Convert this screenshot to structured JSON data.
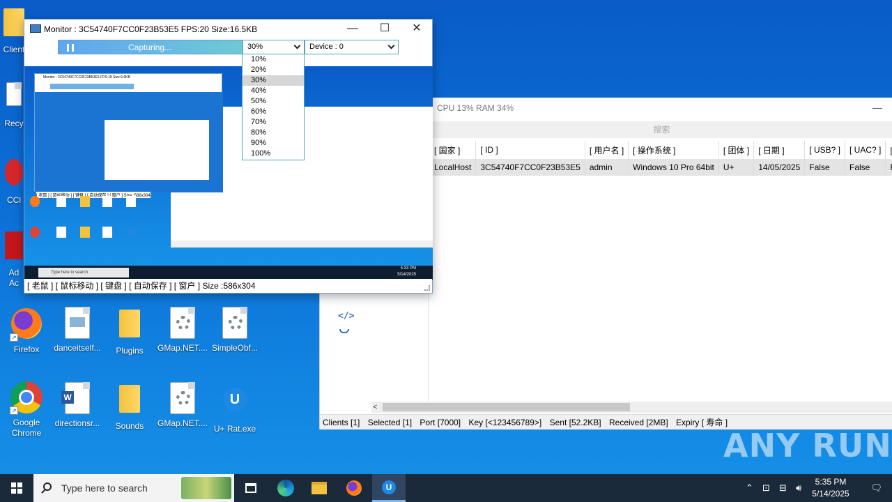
{
  "desktop": {
    "icons": [
      {
        "label": "Firefox"
      },
      {
        "label": "danceitself..."
      },
      {
        "label": "Plugins"
      },
      {
        "label": "GMap.NET...."
      },
      {
        "label": "SimpleObf..."
      },
      {
        "label": "Google Chrome"
      },
      {
        "label": "directionsr..."
      },
      {
        "label": "Sounds"
      },
      {
        "label": "GMap.NET...."
      },
      {
        "label": "U+ Rat.exe"
      }
    ],
    "partial_labels": [
      "Client",
      "Recy",
      "CCl",
      "Ad",
      "Ac"
    ]
  },
  "monitor": {
    "title": "Monitor : 3C54740F7CC0F23B53E5  FPS:20  Size:16.5KB",
    "capture_label": "Capturing...",
    "quality_selected": "30%",
    "device_selected": "Device : 0",
    "quality_options": [
      "10%",
      "20%",
      "30%",
      "40%",
      "50%",
      "60%",
      "70%",
      "80%",
      "90%",
      "100%"
    ],
    "status": {
      "mouse": "[ 老鼠 ]",
      "mouse_move": "[ 鼠标移动 ]",
      "keyboard": "[ 键盘 ]",
      "autosave": "[ 自动保存 ]",
      "window": "[ 窗户 ]",
      "size": "Size :586x304"
    },
    "preview": {
      "mini_title": "Monitor : 3C54740F7CC0F23B53E5  FPS:18  Size:9.6KB",
      "mini_search": "Type here to search",
      "mini_clock_time": "5:33 PM",
      "mini_clock_date": "5/14/2025",
      "mini_status": "[ 老鼠 ] [ 鼠标移动 ] [ 键盘 ] [ 自动保存 ] [ 窗户 ] Size :586x304"
    }
  },
  "main_app": {
    "stats": "CPU 13%  RAM 34%",
    "search_placeholder": "搜索",
    "columns": [
      "[ 国家 ]",
      "[ ID ]",
      "[ 用户名 ]",
      "[ 操作系统 ]",
      "[ 团体 ]",
      "[ 日期 ]",
      "[ USB? ]",
      "[ UAC? ]",
      "[ 相机? ]"
    ],
    "rows": [
      [
        "LocalHost",
        "3C54740F7CC0F23B53E5",
        "admin",
        "Windows 10 Pro 64bit",
        "U+",
        "14/05/2025",
        "False",
        "False",
        "False"
      ]
    ],
    "statusbar": {
      "clients": "Clients [1]",
      "selected": "Selected [1]",
      "port": "Port [7000]",
      "key": "Key [<123456789>]",
      "sent": "Sent [52.2KB]",
      "received": "Received [2MB]",
      "expiry": "Expiry [ 寿命 ]"
    }
  },
  "watermark": "ANY RUN",
  "taskbar": {
    "search_placeholder": "Type here to search",
    "clock_time": "5:35 PM",
    "clock_date": "5/14/2025"
  },
  "colors": {
    "desktop_blue": "#0b6fd6",
    "taskbar": "#1b2a3a",
    "capture_gradient_start": "#5fa6f0",
    "capture_gradient_end": "#6fc9d5"
  }
}
